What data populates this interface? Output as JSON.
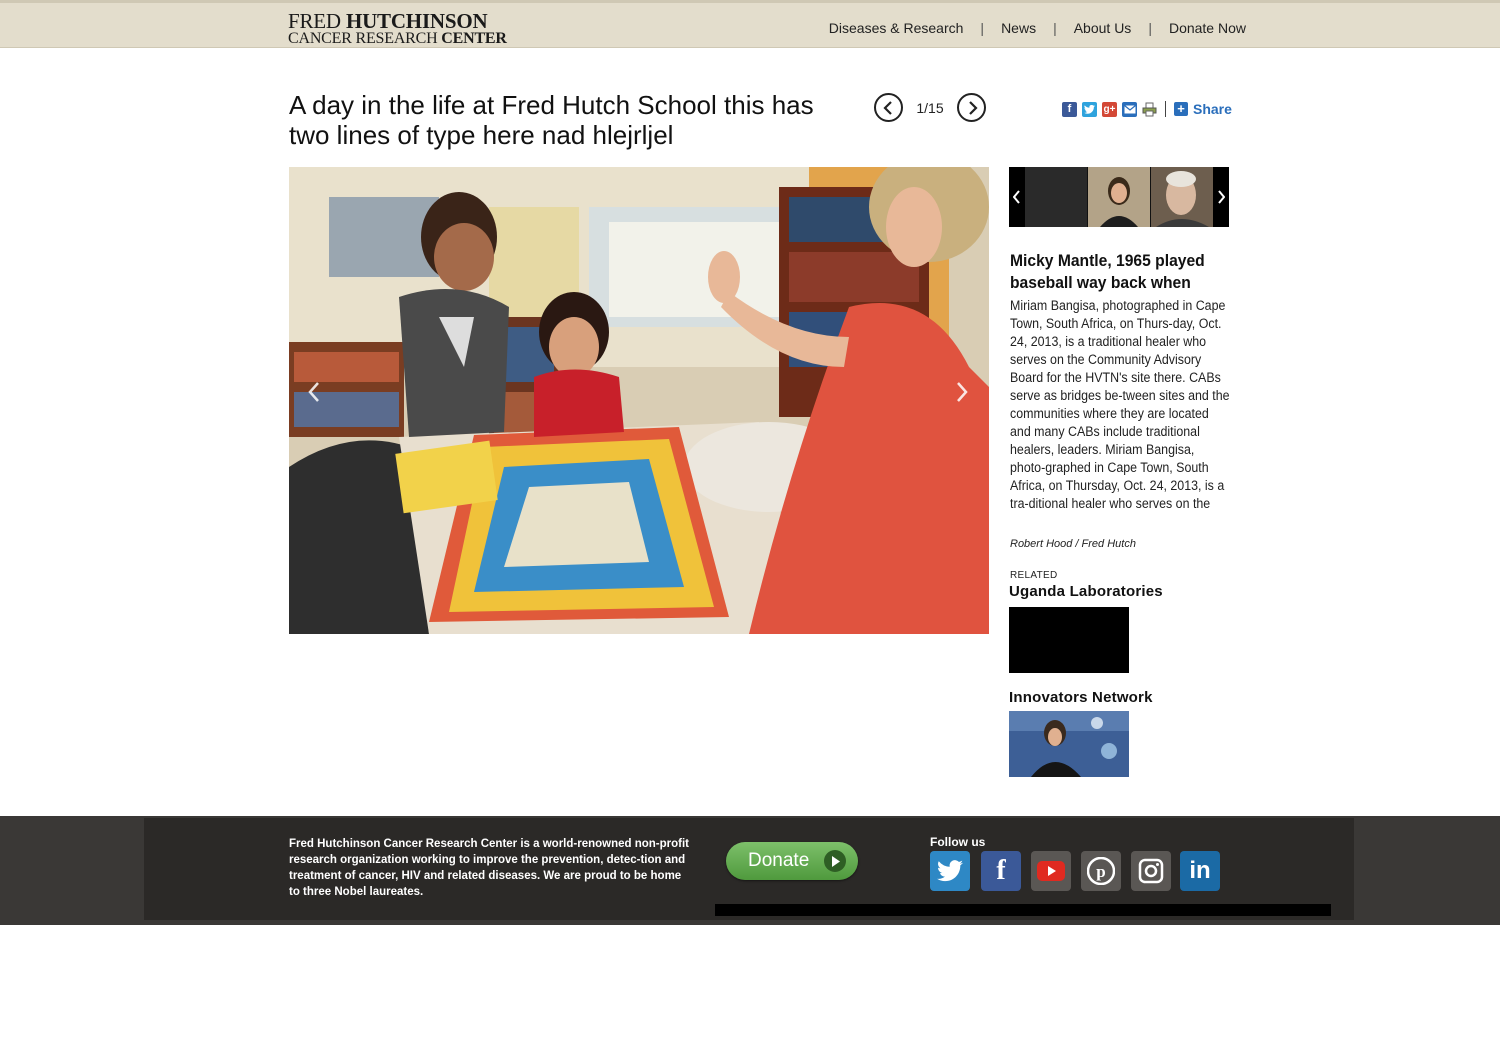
{
  "header": {
    "logo_line1_a": "FRED ",
    "logo_line1_b": "HUTCHINSON",
    "logo_line2_a": "CANCER RESEARCH ",
    "logo_line2_b": "CENTER",
    "nav": [
      "Diseases & Research",
      "News",
      "About Us",
      "Donate Now"
    ],
    "separator": "|"
  },
  "gallery": {
    "title": "A day in the life at Fred Hutch School this has two lines of type here nad hlejrljel",
    "pager_text": "1/15",
    "share_label": "Share"
  },
  "caption": {
    "title": "Micky Mantle, 1965 played baseball way back when",
    "body": "Miriam Bangisa, photographed in Cape Town, South Africa, on Thurs-day, Oct. 24, 2013, is a traditional healer who serves on the Community Advisory Board for the HVTN's site there. CABs serve as bridges be-tween sites and the communities where they are located and many CABs include traditional healers, leaders. Miriam Bangisa, photo-graphed in Cape Town, South Africa, on Thursday, Oct. 24, 2013, is a tra-ditional healer who serves on the",
    "credit": "Robert Hood / Fred Hutch"
  },
  "related": {
    "label": "RELATED",
    "items": [
      {
        "title": "Uganda Laboratories"
      },
      {
        "title": "Innovators Network"
      }
    ]
  },
  "footer": {
    "about": "Fred Hutchinson Cancer Research Center is a world-renowned non-profit research organization working to improve the prevention, detec-tion and treatment of cancer, HIV and related diseases. We are proud to be home to three Nobel laureates.",
    "donate_label": "Donate",
    "follow_label": "Follow us",
    "social": [
      "twitter-icon",
      "facebook-icon",
      "youtube-icon",
      "pinterest-icon",
      "instagram-icon",
      "linkedin-icon"
    ]
  },
  "colors": {
    "header_bg": "#e3ddcc",
    "share_blue": "#2a6ebb",
    "footer_bg": "#2b2927",
    "donate_green": "#5fab4c"
  }
}
